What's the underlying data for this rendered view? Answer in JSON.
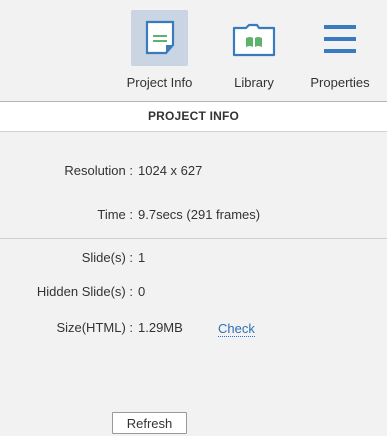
{
  "toolbar": {
    "project_info_label": "Project Info",
    "library_label": "Library",
    "properties_label": "Properties",
    "active_tab": "project_info"
  },
  "section": {
    "title": "PROJECT INFO"
  },
  "info": {
    "resolution_label": "Resolution :",
    "resolution_value": "1024 x 627",
    "time_label": "Time :",
    "time_value": "9.7secs (291 frames)",
    "slides_label": "Slide(s) :",
    "slides_value": "1",
    "hidden_slides_label": "Hidden Slide(s) :",
    "hidden_slides_value": "0",
    "size_label": "Size(HTML) :",
    "size_value": "1.29MB",
    "check_label": "Check"
  },
  "actions": {
    "refresh_label": "Refresh"
  },
  "colors": {
    "accent_blue": "#3a7bbf",
    "library_green": "#5fb26c",
    "active_tab_bg": "#c9d5e2",
    "link": "#2f6fb5"
  },
  "icons": {
    "project_info": "document-icon",
    "library": "folder-icon",
    "properties": "hamburger-menu-icon"
  }
}
